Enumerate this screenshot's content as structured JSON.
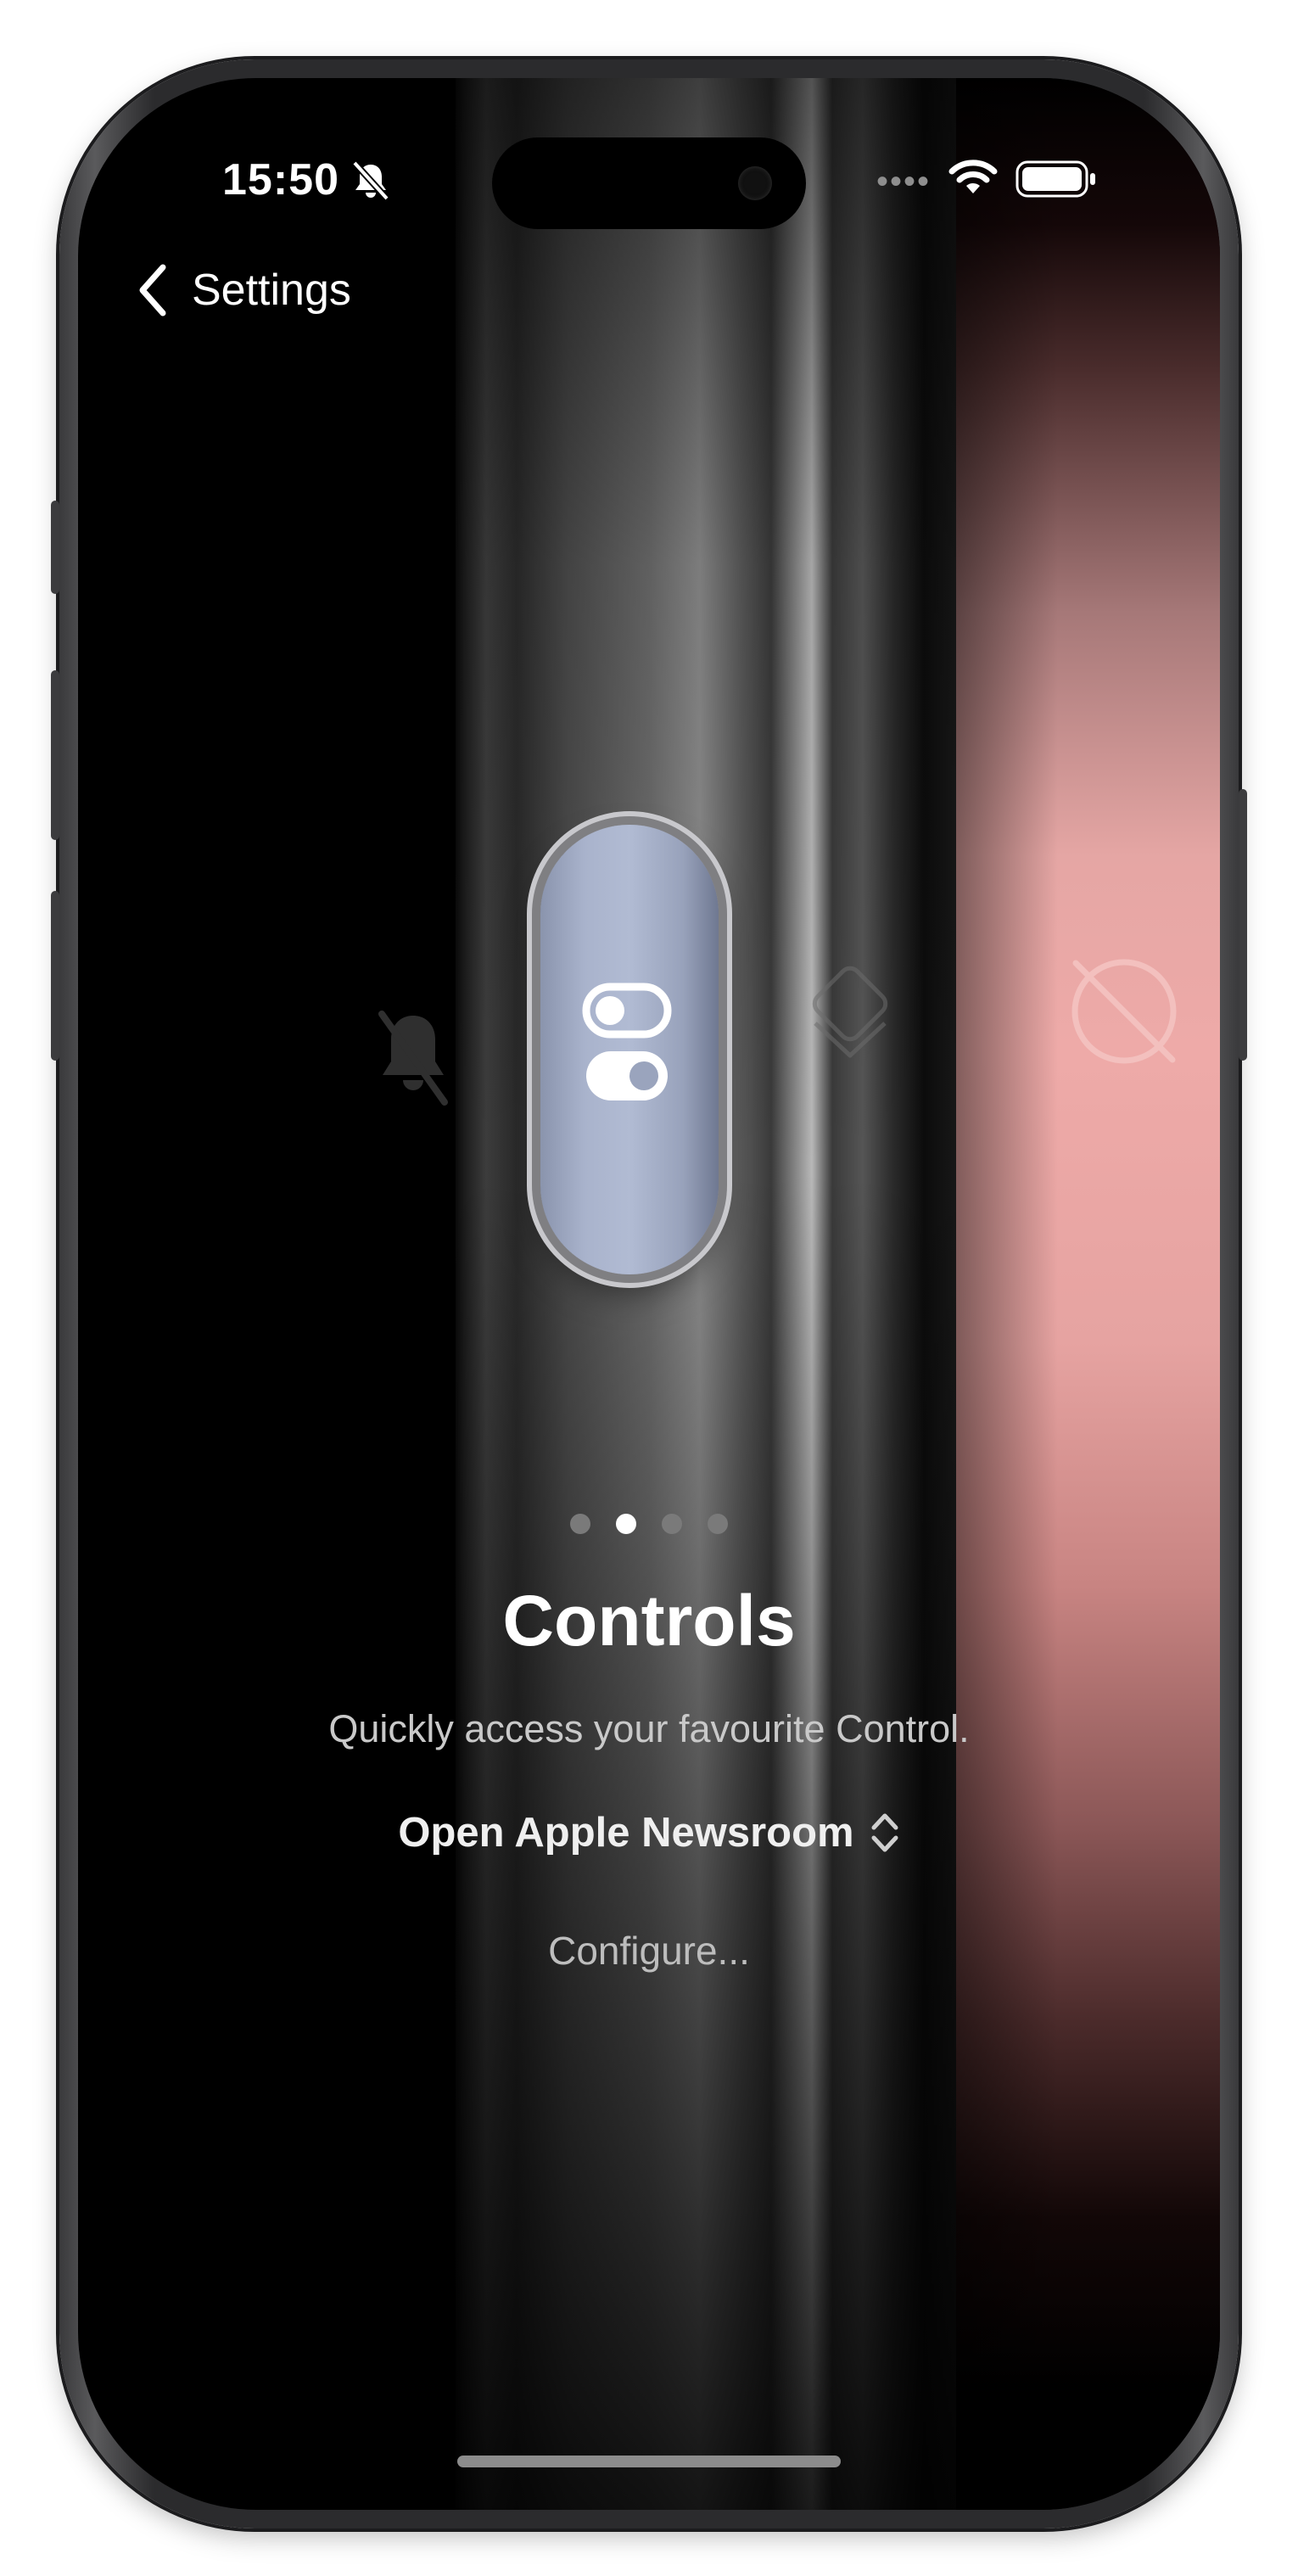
{
  "status_bar": {
    "time": "15:50",
    "silent_icon": "bell-slash-icon",
    "signal": "••••",
    "wifi_icon": "wifi-icon",
    "battery_icon": "battery-icon"
  },
  "nav": {
    "back_label": "Settings",
    "back_icon": "chevron-left-icon"
  },
  "action_button": {
    "current_mode_icon": "controls-toggle-icon",
    "adjacent_modes": [
      "bell-slash-icon",
      "focus-icon",
      "camera-off-icon"
    ]
  },
  "pager": {
    "count": 4,
    "active_index": 1
  },
  "content": {
    "title": "Controls",
    "subtitle": "Quickly access your favourite Control.",
    "selected_control": "Open Apple Newsroom",
    "configure_label": "Configure..."
  },
  "colors": {
    "accent_pink": "#eeaaa8",
    "action_button_blue": "#a9b3cc",
    "text_primary": "#ffffff",
    "text_secondary": "#c9c9c9"
  }
}
